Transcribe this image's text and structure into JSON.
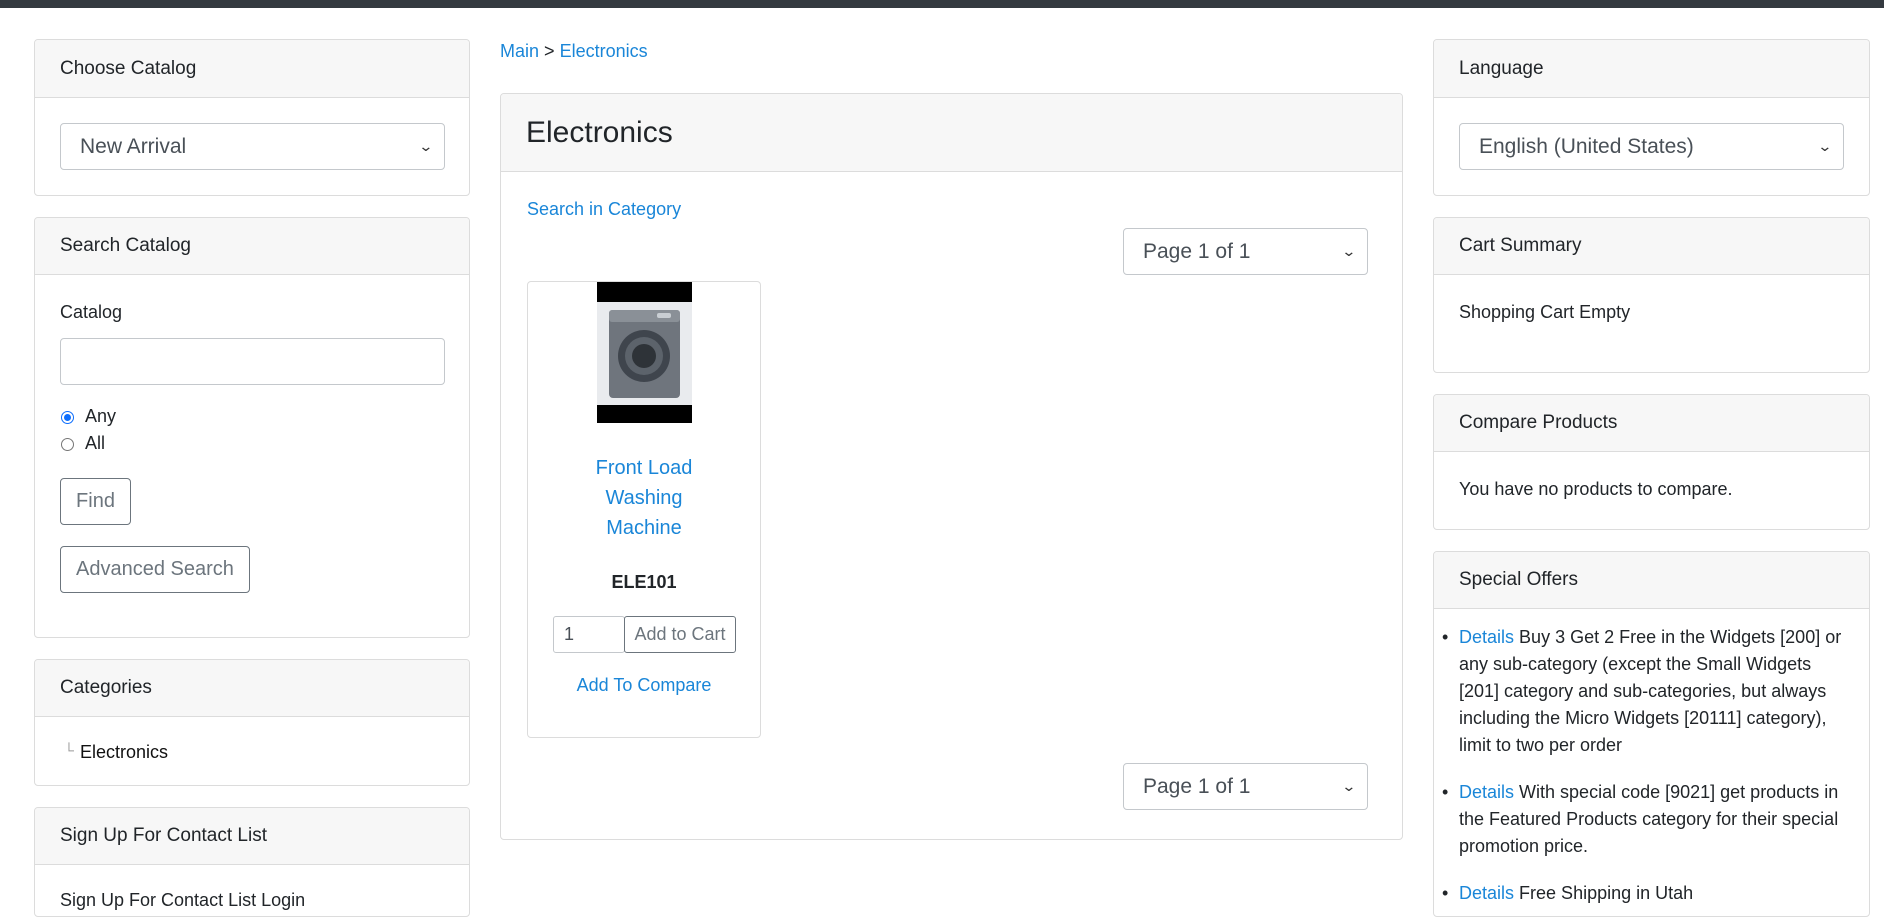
{
  "left": {
    "choose_catalog": {
      "title": "Choose Catalog",
      "selected": "New Arrival"
    },
    "search_catalog": {
      "title": "Search Catalog",
      "catalog_label": "Catalog",
      "catalog_value": "",
      "radio_any": "Any",
      "radio_all": "All",
      "find_button": "Find",
      "advanced_button": "Advanced Search"
    },
    "categories": {
      "title": "Categories",
      "tree_glyph": "└",
      "item": "Electronics"
    },
    "signup": {
      "title": "Sign Up For Contact List",
      "partial_text": "Sign Up For Contact List Login"
    }
  },
  "main": {
    "breadcrumb": {
      "root": "Main",
      "separator": ">",
      "current": "Electronics"
    },
    "title": "Electronics",
    "search_in_category": "Search in Category",
    "pagination_top": "Page 1 of 1",
    "pagination_bottom": "Page 1 of 1",
    "product": {
      "image_icon": "washing-machine-image",
      "name_lines": [
        "Front Load",
        "Washing",
        "Machine"
      ],
      "sku": "ELE101",
      "quantity": "1",
      "add_to_cart": "Add to Cart",
      "add_to_compare": "Add To Compare"
    }
  },
  "right": {
    "language": {
      "title": "Language",
      "selected": "English (United States)"
    },
    "cart_summary": {
      "title": "Cart Summary",
      "text": "Shopping Cart Empty"
    },
    "compare": {
      "title": "Compare Products",
      "text": "You have no products to compare."
    },
    "special_offers": {
      "title": "Special Offers",
      "offers": [
        {
          "link": "Details",
          "lines": [
            "Buy 3 Get 2 Free in the Widgets [200] or",
            "any sub-category (except the Small Widgets",
            "[201] category and sub-categories, but always",
            "including the Micro Widgets [20111] category),",
            "limit to two per order"
          ]
        },
        {
          "link": "Details",
          "lines": [
            "With special code [9021] get products in",
            "the Featured Products category for their special",
            "promotion price."
          ]
        },
        {
          "link": "Details",
          "lines": [
            "Free Shipping in Utah"
          ]
        }
      ]
    }
  },
  "colors": {
    "link": "#1a86d8",
    "topbar": "#343a40",
    "header_bg": "#f7f7f7"
  }
}
